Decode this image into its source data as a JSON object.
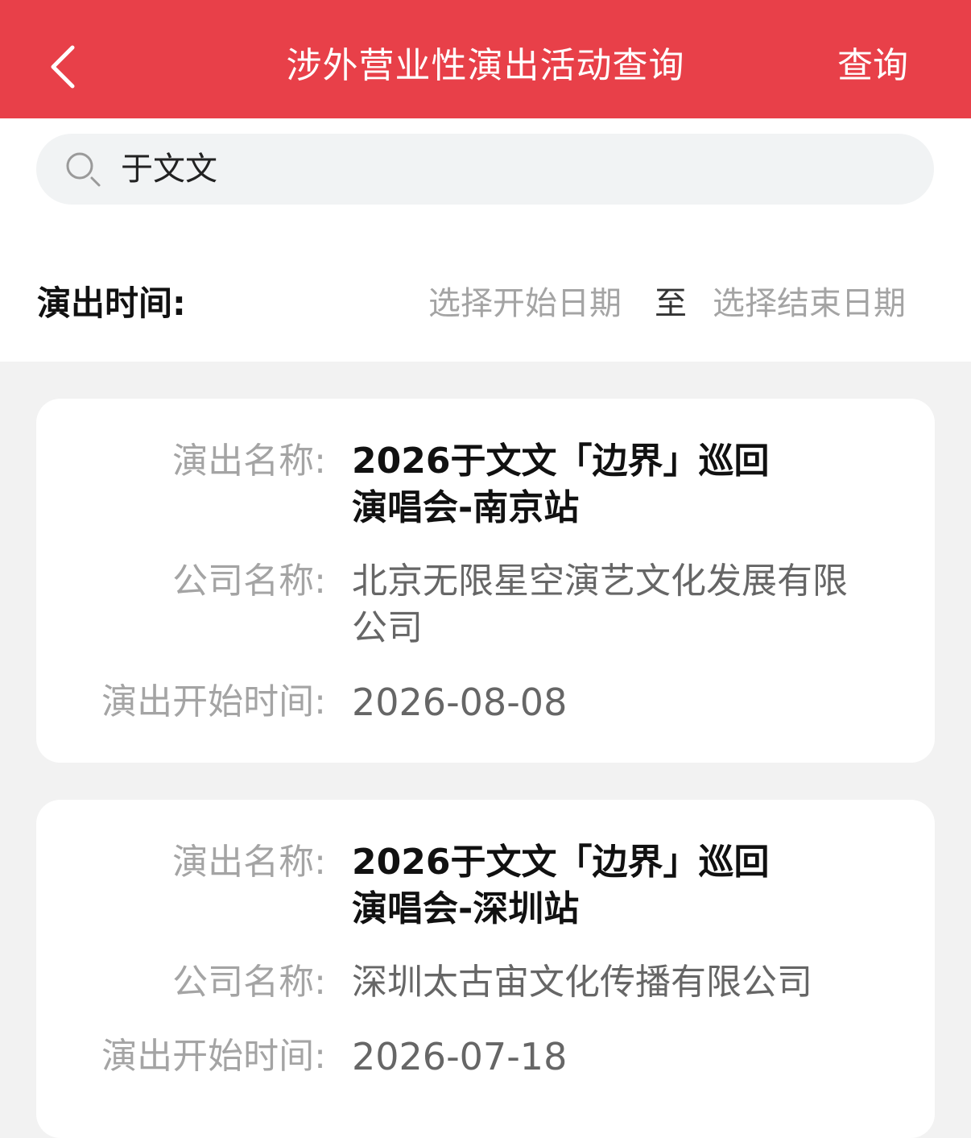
{
  "header": {
    "title": "涉外营业性演出活动查询",
    "action_label": "查询"
  },
  "search": {
    "value": "于文文"
  },
  "date_filter": {
    "label": "演出时间:",
    "start_placeholder": "选择开始日期",
    "separator": "至",
    "end_placeholder": "选择结束日期"
  },
  "labels": {
    "name": "演出名称:",
    "company": "公司名称:",
    "start_time": "演出开始时间:"
  },
  "results": [
    {
      "name_line1": "2026于文文「边界」巡回",
      "name_line2": "演唱会-南京站",
      "company_line1": "北京无限星空演艺文化发展有限",
      "company_line2": "公司",
      "start_date": "2026-08-08"
    },
    {
      "name_line1": "2026于文文「边界」巡回",
      "name_line2": "演唱会-深圳站",
      "company_line1": "深圳太古宙文化传播有限公司",
      "start_date": "2026-07-18"
    }
  ],
  "colors": {
    "brand_red": "#e84049",
    "placeholder_gray": "#a4a4a4"
  }
}
